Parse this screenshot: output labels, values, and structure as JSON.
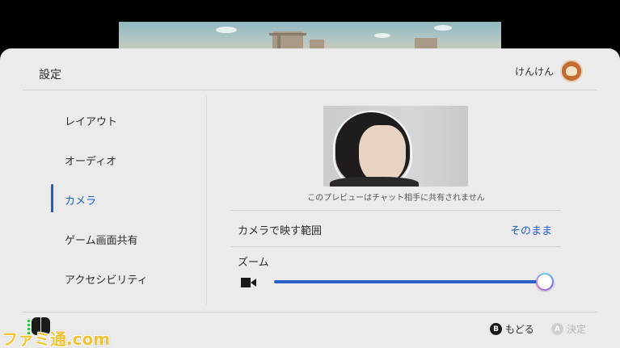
{
  "header": {
    "title": "設定",
    "user_name": "けんけん"
  },
  "sidebar": {
    "items": [
      {
        "label": "レイアウト",
        "active": false
      },
      {
        "label": "オーディオ",
        "active": false
      },
      {
        "label": "カメラ",
        "active": true
      },
      {
        "label": "ゲーム画面共有",
        "active": false
      },
      {
        "label": "アクセシビリティ",
        "active": false
      }
    ]
  },
  "camera": {
    "preview_note": "このプレビューはチャット相手に共有されません",
    "range_label": "カメラで映す範囲",
    "range_value": "そのまま",
    "zoom_label": "ズーム",
    "zoom_level": 1.0
  },
  "footer": {
    "back_button_glyph": "B",
    "back_label": "もどる",
    "ok_button_glyph": "A",
    "ok_label": "決定"
  },
  "watermark": "ファミ通.com",
  "colors": {
    "accent": "#1f5fc6",
    "sheet_bg": "#ebebeb",
    "text": "#2d2d2d",
    "disabled": "#b5b5b5"
  }
}
